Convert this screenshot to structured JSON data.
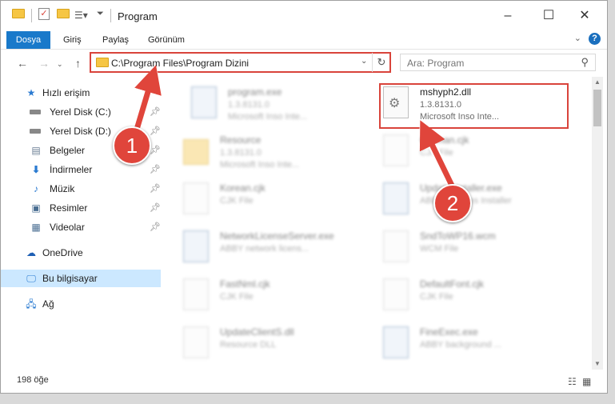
{
  "window": {
    "title": "Program"
  },
  "ribbon": {
    "tabs": [
      "Dosya",
      "Giriş",
      "Paylaş",
      "Görünüm"
    ]
  },
  "address": {
    "path": "C:\\Program Files\\Program Dizini"
  },
  "search": {
    "placeholder": "Ara: Program"
  },
  "sidebar": {
    "items": [
      {
        "label": "Hızlı erişim",
        "icon": "star-icon"
      },
      {
        "label": "Yerel Disk (C:)",
        "icon": "drive-icon",
        "pinned": true
      },
      {
        "label": "Yerel Disk (D:)",
        "icon": "drive-icon",
        "pinned": true
      },
      {
        "label": "Belgeler",
        "icon": "documents-icon",
        "pinned": true
      },
      {
        "label": "İndirmeler",
        "icon": "download-icon",
        "pinned": true
      },
      {
        "label": "Müzik",
        "icon": "music-icon",
        "pinned": true
      },
      {
        "label": "Resimler",
        "icon": "pictures-icon",
        "pinned": true
      },
      {
        "label": "Videolar",
        "icon": "videos-icon",
        "pinned": true
      },
      {
        "label": "OneDrive",
        "icon": "cloud-icon"
      },
      {
        "label": "Bu bilgisayar",
        "icon": "computer-icon",
        "selected": true
      },
      {
        "label": "Ağ",
        "icon": "network-icon"
      }
    ]
  },
  "files": [
    {
      "name": "program.exe",
      "line1": "1.3.8131.0",
      "line2": "Microsoft Inso Inte..."
    },
    {
      "name": "mshyph2.dll",
      "line1": "1.3.8131.0",
      "line2": "Microsoft Inso Inte..."
    },
    {
      "name": "Resource",
      "line1": "1.3.8131.0",
      "line2": "Microsoft Inso Inte..."
    },
    {
      "name": "German.cjk",
      "line1": "CJK File",
      "line2": ""
    },
    {
      "name": "Korean.cjk",
      "line1": "CJK File",
      "line2": ""
    },
    {
      "name": "UpdateInstaller.exe",
      "line1": "ABBY Updates Installer",
      "line2": ""
    },
    {
      "name": "NetworkLicenseServer.exe",
      "line1": "ABBY network licens...",
      "line2": ""
    },
    {
      "name": "SndToWP16.wcm",
      "line1": "WCM File",
      "line2": ""
    },
    {
      "name": "FastNml.cjk",
      "line1": "CJK File",
      "line2": ""
    },
    {
      "name": "DefaultFont.cjk",
      "line1": "CJK File",
      "line2": ""
    },
    {
      "name": "UpdateClientS.dll",
      "line1": "Resource DLL",
      "line2": ""
    },
    {
      "name": "FineExec.exe",
      "line1": "ABBY background ...",
      "line2": ""
    }
  ],
  "status": {
    "count": "198 öğe"
  },
  "annotations": {
    "step1": "1",
    "step2": "2",
    "color": "#e0453b"
  }
}
